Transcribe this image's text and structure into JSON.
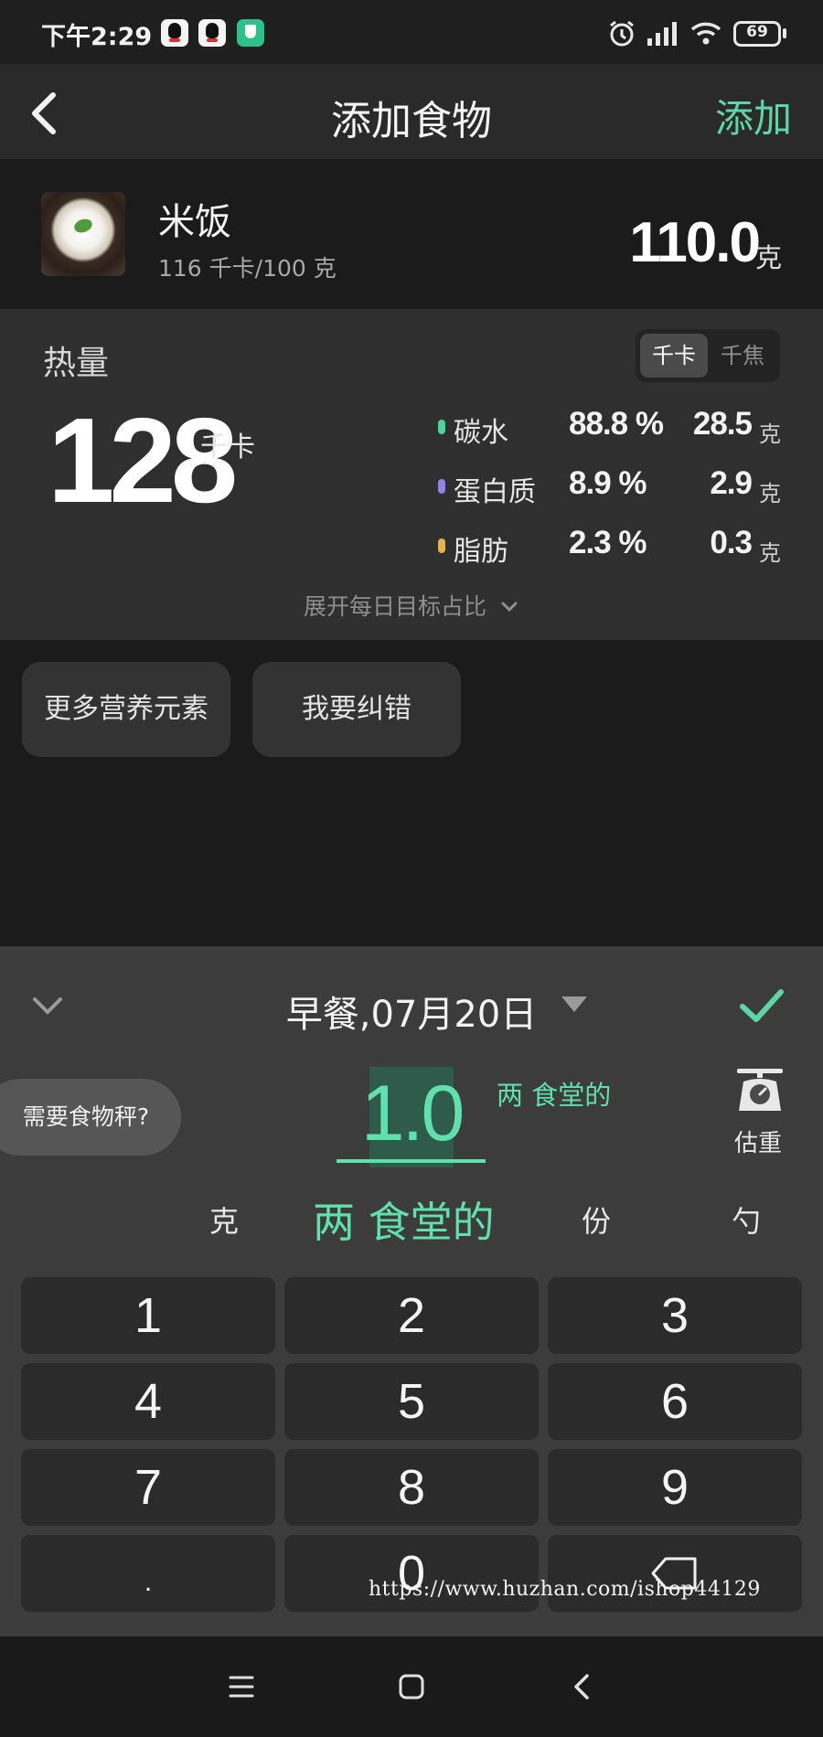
{
  "status_bar": {
    "time": "下午2:29",
    "battery": "69",
    "icons": [
      "qq-icon",
      "qq-icon",
      "security-app-icon",
      "alarm-icon",
      "signal-icon",
      "wifi-icon",
      "battery-icon"
    ]
  },
  "header": {
    "title": "添加食物",
    "action_label": "添加",
    "accent_color": "#5cd6a8"
  },
  "food": {
    "name": "米饭",
    "kcal_per_100g": "116 千卡/100 克",
    "weight": "110.0",
    "weight_unit": "克"
  },
  "calories": {
    "label": "热量",
    "unit_toggle": {
      "kcal": "千卡",
      "kj": "千焦",
      "selected": "千卡"
    },
    "value": "128",
    "unit": "千卡",
    "macros": [
      {
        "name": "碳水",
        "percent": "88.8 %",
        "amount": "28.5",
        "unit": "克",
        "color": "#4ad1a0"
      },
      {
        "name": "蛋白质",
        "percent": "8.9 %",
        "amount": "2.9",
        "unit": "克",
        "color": "#8f84e8"
      },
      {
        "name": "脂肪",
        "percent": "2.3 %",
        "amount": "0.3",
        "unit": "克",
        "color": "#e8b24a"
      }
    ],
    "expand_label": "展开每日目标占比"
  },
  "actions": {
    "more_nutrients": "更多营养元素",
    "report_error": "我要纠错"
  },
  "sheet": {
    "meal": "早餐,07月20日",
    "need_scale": "需要食物秤?",
    "quantity": "1.0",
    "quantity_unit": "两 食堂的",
    "estimate_label": "估重",
    "units": {
      "gram": "克",
      "liang": "两 食堂的",
      "portion": "份",
      "spoon": "勺"
    },
    "selected_unit": "两 食堂的"
  },
  "keypad": {
    "keys": [
      "1",
      "2",
      "3",
      "4",
      "5",
      "6",
      "7",
      "8",
      "9",
      ".",
      "0"
    ]
  },
  "watermark": "https://www.huzhan.com/ishop44129"
}
